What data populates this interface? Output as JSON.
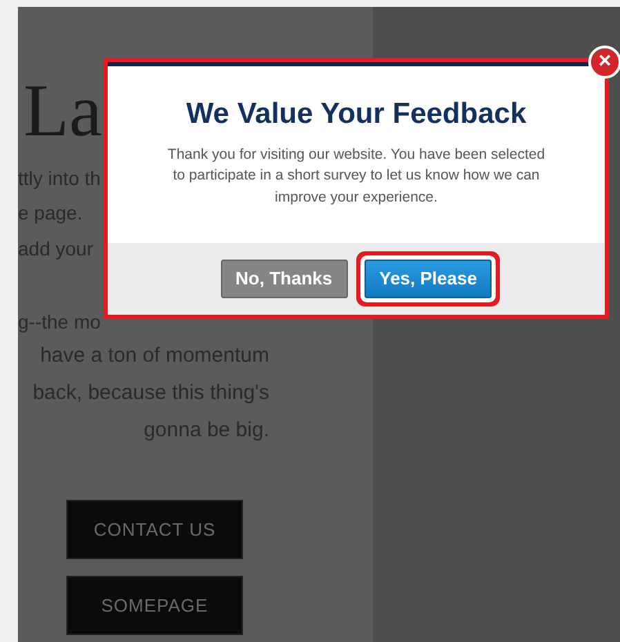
{
  "page": {
    "heading": "La",
    "fragments": [
      "ttly into th",
      "e page.",
      "add your",
      "g--the mo"
    ],
    "paragraph_lines": [
      "have a ton of momentum",
      "back, because this thing's",
      "gonna be big."
    ],
    "buttons": [
      "CONTACT US",
      "SOMEPAGE"
    ]
  },
  "dialog": {
    "highlighted": true,
    "close": "×",
    "title": "We Value Your Feedback",
    "message": "Thank you for visiting our website. You have been selected to participate in a short survey to let us know how we can improve your experience.",
    "buttons": [
      {
        "label": "No, Thanks",
        "kind": "secondary",
        "highlighted": false
      },
      {
        "label": "Yes, Please",
        "kind": "primary",
        "highlighted": true
      }
    ]
  }
}
